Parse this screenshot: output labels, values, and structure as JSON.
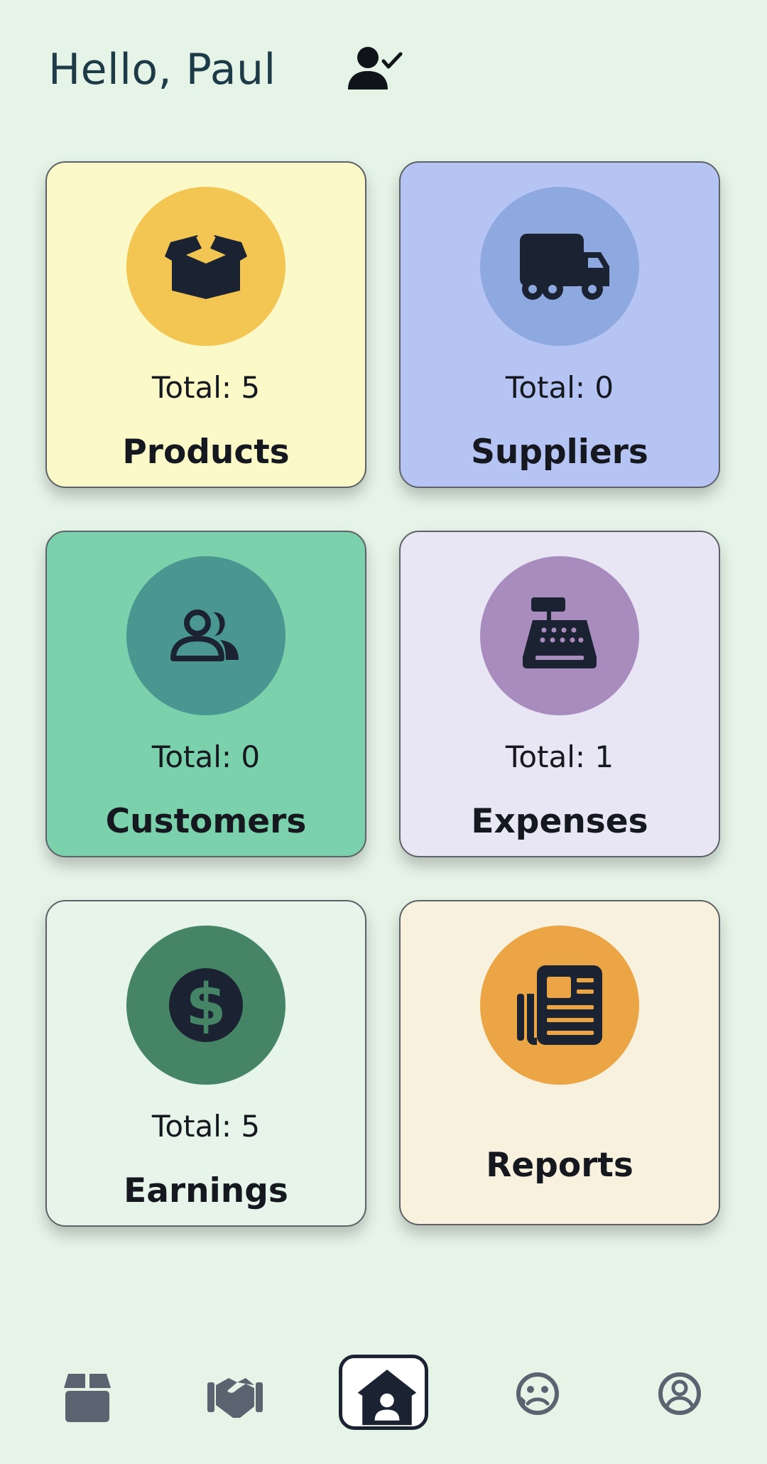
{
  "header": {
    "greeting": "Hello, Paul",
    "icon": "user-check-icon"
  },
  "cards": {
    "products": {
      "total": "Total: 5",
      "label": "Products",
      "icon": "open-box-icon",
      "bg": "#fbf9c7",
      "circle": "#f3c553"
    },
    "suppliers": {
      "total": "Total: 0",
      "label": "Suppliers",
      "icon": "truck-icon",
      "bg": "#b5c4f2",
      "circle": "#8ea8e0"
    },
    "customers": {
      "total": "Total: 0",
      "label": "Customers",
      "icon": "users-icon",
      "bg": "#7bd1ab",
      "circle": "#4a9691"
    },
    "expenses": {
      "total": "Total: 1",
      "label": "Expenses",
      "icon": "cash-register-icon",
      "bg": "#e8e6f4",
      "circle": "#a98cbe"
    },
    "earnings": {
      "total": "Total: 5",
      "label": "Earnings",
      "icon": "dollar-icon",
      "bg": "#e7f4e9",
      "circle": "#458566"
    },
    "reports": {
      "label": "Reports",
      "icon": "newspaper-icon",
      "bg": "#f8f1de",
      "circle": "#eba545"
    }
  },
  "bottom_nav": {
    "items": [
      {
        "icon": "box-icon",
        "active": false
      },
      {
        "icon": "handshake-icon",
        "active": false
      },
      {
        "icon": "home-user-icon",
        "active": true
      },
      {
        "icon": "sad-face-icon",
        "active": false
      },
      {
        "icon": "user-circle-icon",
        "active": false
      }
    ]
  },
  "colors": {
    "background": "#e6f4e8",
    "icon_dark": "#1b2232",
    "nav_icon": "#5a6470"
  }
}
